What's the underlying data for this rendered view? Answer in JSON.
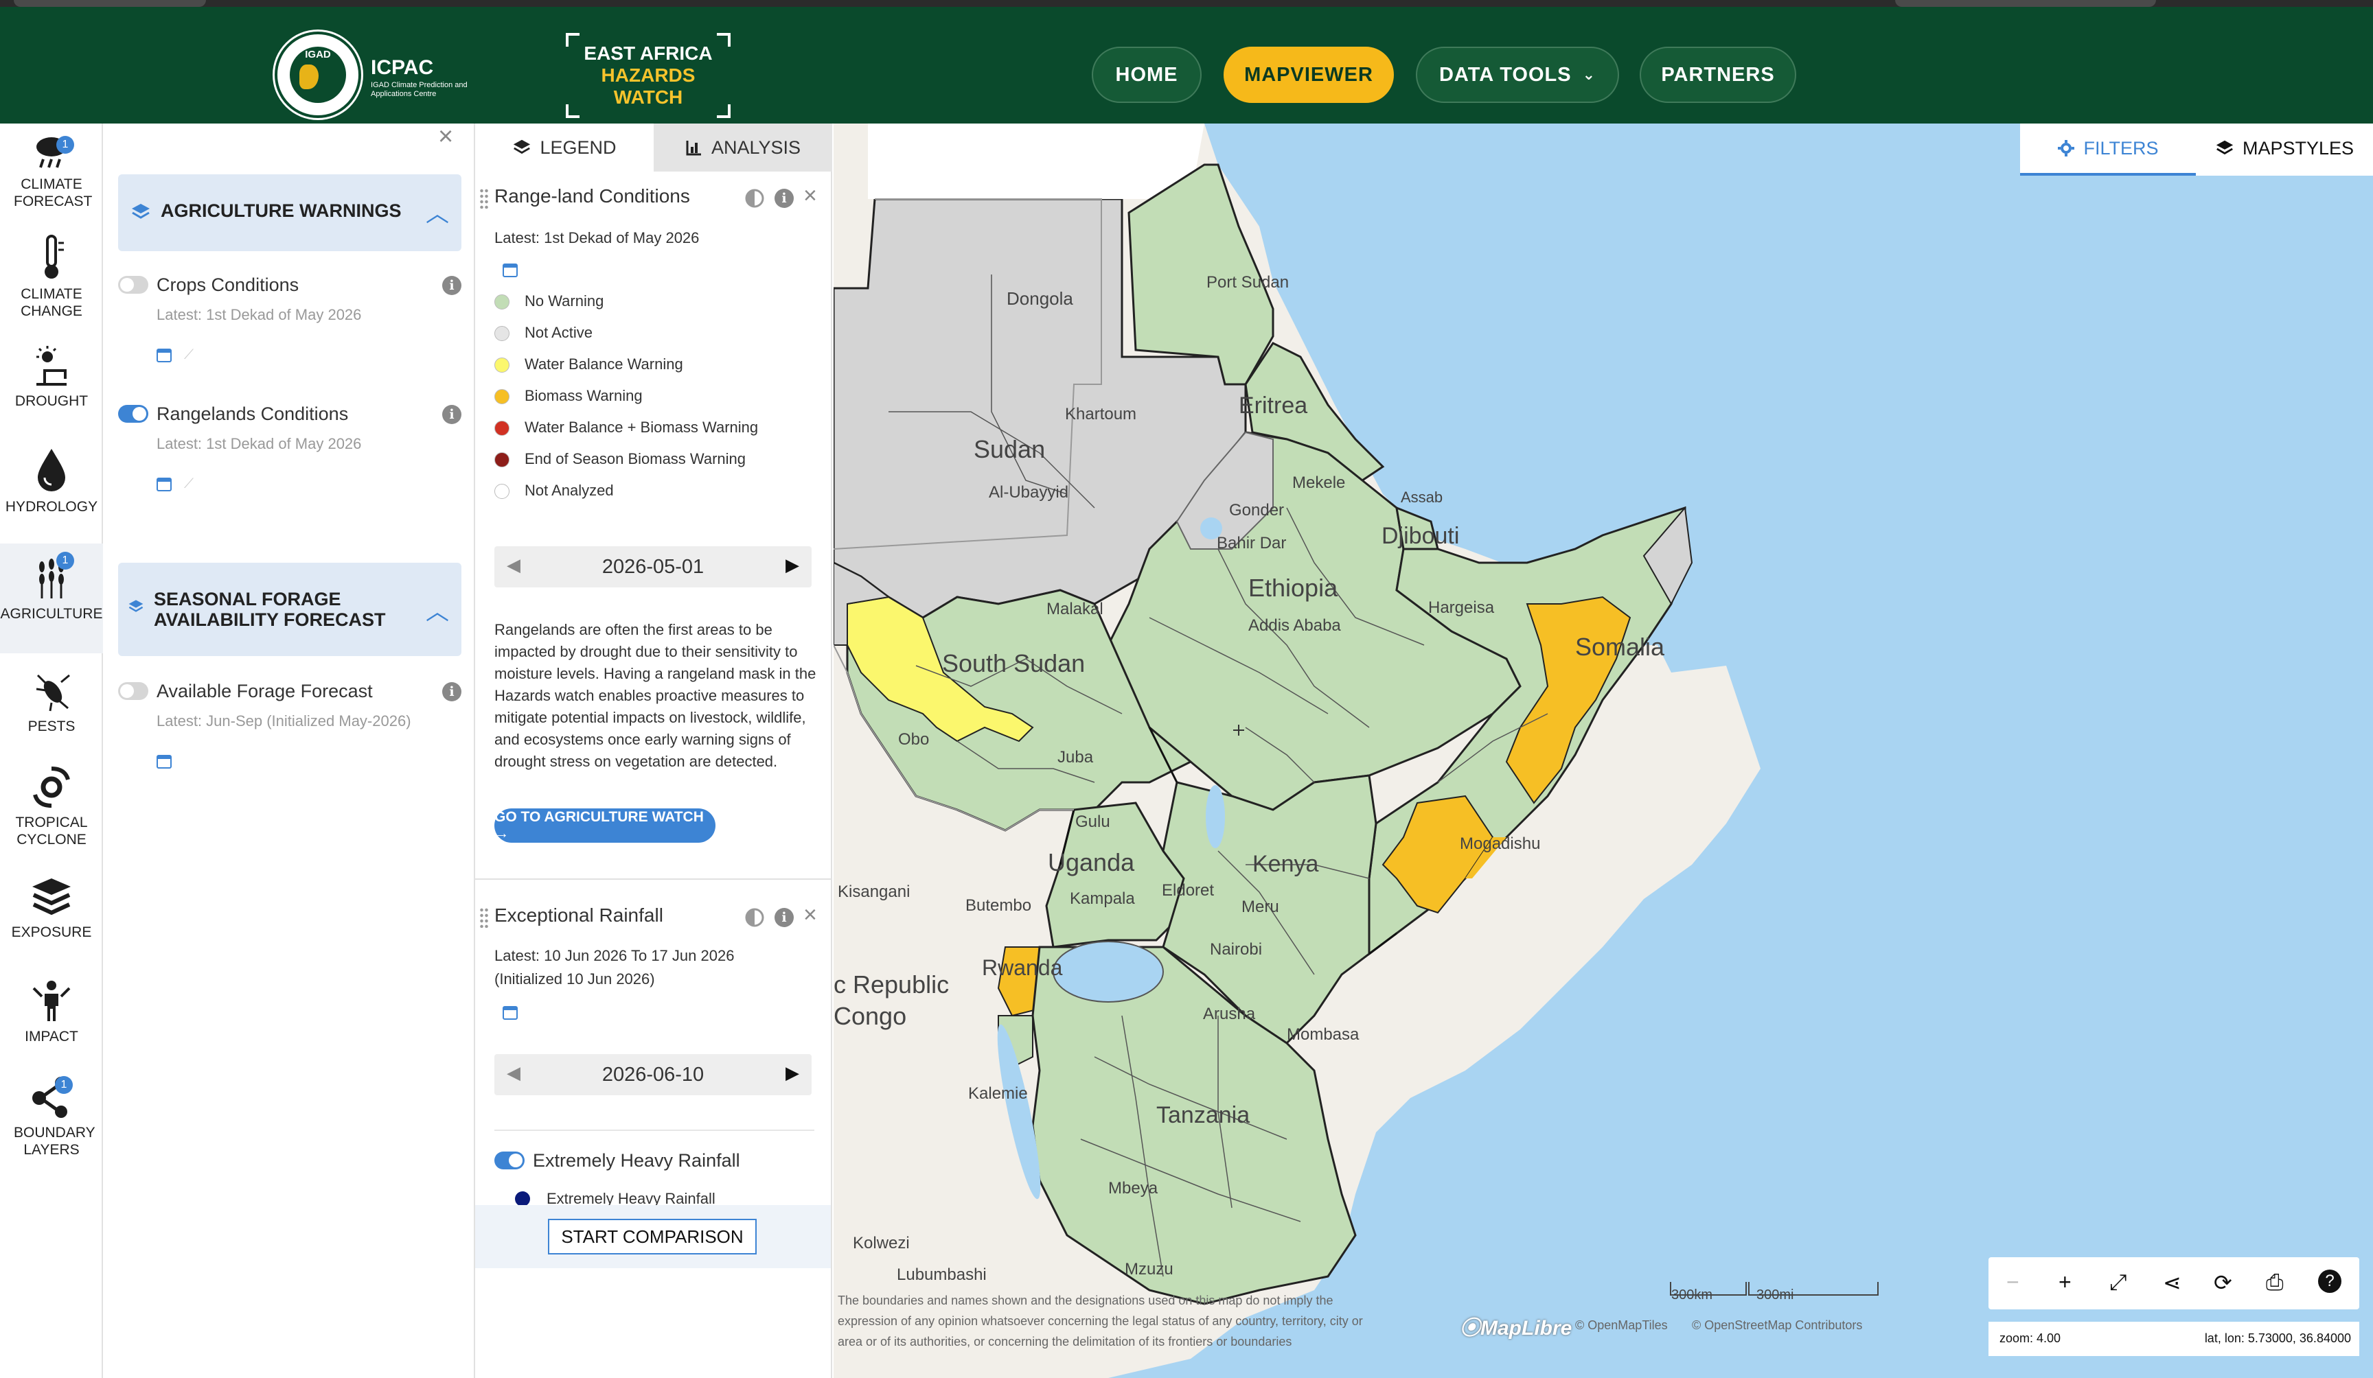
{
  "header": {
    "org_name": "ICPAC",
    "org_sub": "IGAD Climate Prediction and Applications Centre",
    "org_badge": "IGAD",
    "brand_line1": "EAST AFRICA",
    "brand_line2": "HAZARDS",
    "brand_line3": "WATCH",
    "nav": [
      {
        "label": "HOME"
      },
      {
        "label": "MAPVIEWER"
      },
      {
        "label": "DATA TOOLS"
      },
      {
        "label": "PARTNERS"
      }
    ],
    "colors": {
      "bg": "#0a4a2c",
      "accent": "#f6b91a"
    }
  },
  "sidebar": {
    "items": [
      {
        "label": "CLIMATE FORECAST",
        "icon": "cloud-rain-icon",
        "badge": "1"
      },
      {
        "label": "CLIMATE CHANGE",
        "icon": "thermometer-icon"
      },
      {
        "label": "DROUGHT",
        "icon": "drought-sun-icon"
      },
      {
        "label": "HYDROLOGY",
        "icon": "water-drop-icon"
      },
      {
        "label": "AGRICULTURE",
        "icon": "wheat-icon",
        "badge": "1"
      },
      {
        "label": "PESTS",
        "icon": "locust-icon"
      },
      {
        "label": "TROPICAL CYCLONE",
        "icon": "cyclone-icon"
      },
      {
        "label": "EXPOSURE",
        "icon": "layers-icon"
      },
      {
        "label": "IMPACT",
        "icon": "person-icon"
      },
      {
        "label": "BOUNDARY LAYERS",
        "icon": "share-nodes-icon",
        "badge": "1"
      }
    ]
  },
  "layers_panel": {
    "group1": {
      "title": "AGRICULTURE WARNINGS",
      "layers": [
        {
          "name": "Crops Conditions",
          "latest": "Latest: 1st Dekad of May 2026",
          "on": false
        },
        {
          "name": "Rangelands Conditions",
          "latest": "Latest: 1st Dekad of May 2026",
          "on": true
        }
      ]
    },
    "group2": {
      "title_line1": "SEASONAL FORAGE",
      "title_line2": "AVAILABILITY FORECAST",
      "layers": [
        {
          "name": "Available Forage Forecast",
          "latest": "Latest: Jun-Sep (Initialized May-2026)",
          "on": false
        }
      ]
    }
  },
  "legend_panel": {
    "tabs": [
      {
        "label": "LEGEND"
      },
      {
        "label": "ANALYSIS"
      }
    ],
    "rangeland": {
      "title": "Range-land Conditions",
      "latest": "Latest: 1st Dekad of May 2026",
      "items": [
        {
          "label": "No Warning",
          "color": "#c2ddb6"
        },
        {
          "label": "Not Active",
          "color": "#e5e5e5"
        },
        {
          "label": "Water Balance Warning",
          "color": "#fbf76d"
        },
        {
          "label": "Biomass Warning",
          "color": "#f6bf25"
        },
        {
          "label": "Water Balance + Biomass Warning",
          "color": "#d13123"
        },
        {
          "label": "End of Season Biomass Warning",
          "color": "#8d1d19"
        },
        {
          "label": "Not Analyzed",
          "color": "#ffffff"
        }
      ],
      "date": "2026-05-01",
      "description": "Rangelands are often the first areas to be impacted by drought due to their sensitivity to moisture levels. Having a rangeland mask in the Hazards watch enables proactive measures to mitigate potential impacts on livestock, wildlife, and ecosystems once early warning signs of drought stress on vegetation are detected.",
      "cta": "GO TO AGRICULTURE WATCH →"
    },
    "rainfall": {
      "title": "Exceptional Rainfall",
      "latest_line1": "Latest: 10 Jun 2026 To 17 Jun 2026",
      "latest_line2": "(Initialized 10 Jun 2026)",
      "date": "2026-06-10",
      "toggle_label": "Extremely Heavy Rainfall",
      "sub_item": "Extremely Heavy Rainfall"
    },
    "compare_button": "START COMPARISON"
  },
  "map": {
    "tabs": [
      {
        "label": "FILTERS"
      },
      {
        "label": "MAPSTYLES"
      }
    ],
    "labels": {
      "port_sudan": "Port Sudan",
      "dongola": "Dongola",
      "khartoum": "Khartoum",
      "sudan": "Sudan",
      "al_ubayyid": "Al-Ubayyid",
      "eritrea": "Eritrea",
      "assab": "Assab",
      "mekele": "Mekele",
      "gonder": "Gonder",
      "bahir_dar": "Bahir Dar",
      "djibouti": "Djibouti",
      "ethiopia": "Ethiopia",
      "addis": "Addis Ababa",
      "hargeisa": "Hargeisa",
      "somalia": "Somalia",
      "malakal": "Malakal",
      "south_sudan": "South Sudan",
      "juba": "Juba",
      "obo": "Obo",
      "gulu": "Gulu",
      "uganda": "Uganda",
      "kampala": "Kampala",
      "eldoret": "Eldoret",
      "kenya": "Kenya",
      "meru": "Meru",
      "nairobi": "Nairobi",
      "mogadishu": "Mogadishu",
      "kisangani": "Kisangani",
      "butembo": "Butembo",
      "rwanda": "Rwanda",
      "drc1": "c Republic",
      "drc2": "Congo",
      "arusha": "Arusha",
      "mombasa": "Mombasa",
      "kalemie": "Kalemie",
      "tanzania": "Tanzania",
      "mbeya": "Mbeya",
      "kolwezi": "Kolwezi",
      "lubumbashi": "Lubumbashi",
      "mzuzu": "Mzuzu"
    },
    "disclaimer_l1": "The boundaries and names shown and the designations used on this map do not imply the",
    "disclaimer_l2": "expression of any opinion whatsoever concerning the legal status of any country, territory, city or",
    "disclaimer_l3": "area or of its authorities, or concerning the delimitation of its frontiers or boundaries",
    "maplibre": "MapLibre",
    "attrib1": "© OpenMapTiles",
    "attrib2": "© OpenStreetMap Contributors",
    "scale_km": "300km",
    "scale_mi": "300mi",
    "zoom": "zoom: 4.00",
    "latlon": "lat, lon: 5.73000, 36.84000"
  }
}
